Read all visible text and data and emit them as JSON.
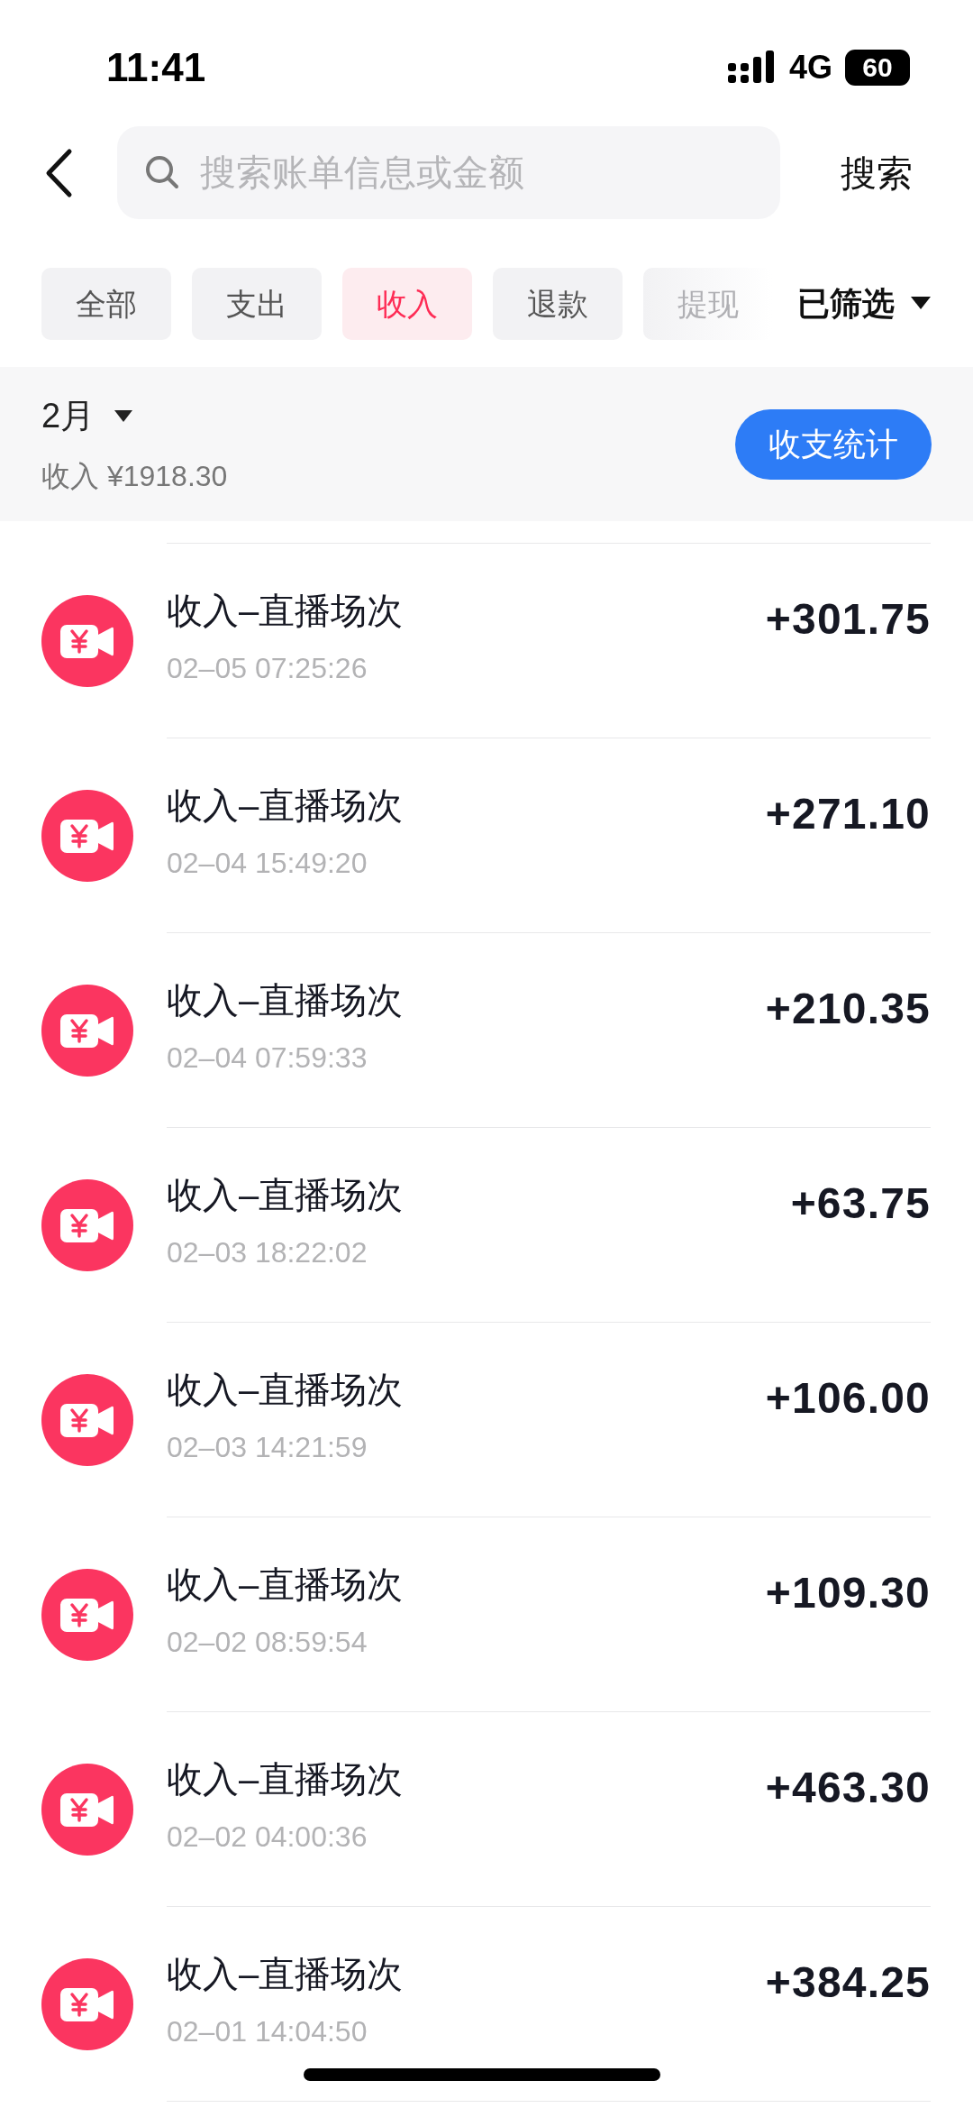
{
  "status_bar": {
    "time": "11:41",
    "network": "4G",
    "battery": "60"
  },
  "search": {
    "placeholder": "搜索账单信息或金额",
    "button": "搜索"
  },
  "tabs": [
    {
      "label": "全部",
      "selected": false
    },
    {
      "label": "支出",
      "selected": false
    },
    {
      "label": "收入",
      "selected": true
    },
    {
      "label": "退款",
      "selected": false
    },
    {
      "label": "提现",
      "selected": false
    }
  ],
  "filter": {
    "label": "已筛选"
  },
  "summary": {
    "month": "2月",
    "total": "收入 ¥1918.30",
    "stats_button": "收支统计"
  },
  "transactions": [
    {
      "title": "收入–直播场次",
      "time": "02–05 07:25:26",
      "amount": "+301.75"
    },
    {
      "title": "收入–直播场次",
      "time": "02–04 15:49:20",
      "amount": "+271.10"
    },
    {
      "title": "收入–直播场次",
      "time": "02–04 07:59:33",
      "amount": "+210.35"
    },
    {
      "title": "收入–直播场次",
      "time": "02–03 18:22:02",
      "amount": "+63.75"
    },
    {
      "title": "收入–直播场次",
      "time": "02–03 14:21:59",
      "amount": "+106.00"
    },
    {
      "title": "收入–直播场次",
      "time": "02–02 08:59:54",
      "amount": "+109.30"
    },
    {
      "title": "收入–直播场次",
      "time": "02–02 04:00:36",
      "amount": "+463.30"
    },
    {
      "title": "收入–直播场次",
      "time": "02–01 14:04:50",
      "amount": "+384.25"
    }
  ]
}
